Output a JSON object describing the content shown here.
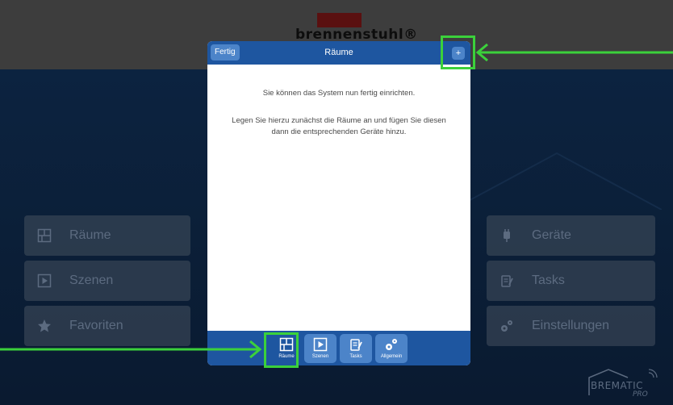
{
  "brand": {
    "name": "brennenstuhl®"
  },
  "background_tiles": {
    "left": [
      {
        "label": "Räume",
        "icon": "rooms-icon"
      },
      {
        "label": "Szenen",
        "icon": "scenes-icon"
      },
      {
        "label": "Favoriten",
        "icon": "star-icon"
      }
    ],
    "right": [
      {
        "label": "Geräte",
        "icon": "plug-icon"
      },
      {
        "label": "Tasks",
        "icon": "tasks-icon"
      },
      {
        "label": "Einstellungen",
        "icon": "gears-icon"
      }
    ]
  },
  "modal": {
    "title": "Räume",
    "done_label": "Fertig",
    "add_label": "+",
    "message_1": "Sie können das System nun fertig einrichten.",
    "message_2": "Legen Sie hierzu zunächst die Räume an und fügen Sie diesen dann die entsprechenden Geräte hinzu.",
    "tabs": [
      {
        "label": "Räume",
        "icon": "rooms-icon",
        "active": true
      },
      {
        "label": "Szenen",
        "icon": "scenes-icon",
        "active": false
      },
      {
        "label": "Tasks",
        "icon": "tasks-icon",
        "active": false
      },
      {
        "label": "Allgemein",
        "icon": "gears-icon",
        "active": false
      }
    ]
  },
  "footer_logo": {
    "line1": "BREMATIC",
    "line2": "PRO"
  },
  "colors": {
    "modal_header": "#1e56a0",
    "button": "#4c84c9",
    "highlight": "#3bd13b",
    "tile_text": "#5c6b80"
  }
}
